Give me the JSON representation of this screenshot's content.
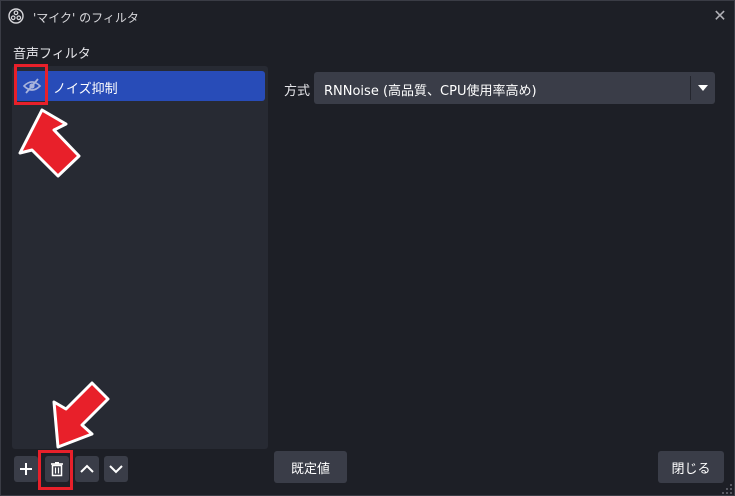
{
  "window": {
    "title": "'マイク' のフィルタ"
  },
  "filters_panel": {
    "section_label": "音声フィルタ",
    "items": [
      {
        "label": "ノイズ抑制",
        "visibility_icon": "eye-slash-icon",
        "selected": true
      }
    ]
  },
  "toolbar": {
    "add_icon": "plus-icon",
    "remove_icon": "trash-icon",
    "up_icon": "chevron-up-icon",
    "down_icon": "chevron-down-icon"
  },
  "properties": {
    "method_label": "方式",
    "method_value": "RNNoise (高品質、CPU使用率高め)"
  },
  "buttons": {
    "defaults": "既定値",
    "close": "閉じる"
  },
  "colors": {
    "background": "#1d1f26",
    "panel": "#272a33",
    "selected": "#284cb8",
    "control": "#3a3d48",
    "annotation": "#e8202a"
  }
}
